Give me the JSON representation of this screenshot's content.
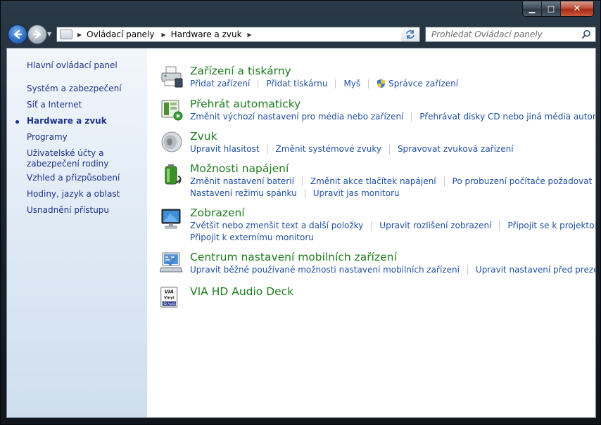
{
  "window": {
    "caption": {
      "minimize": "▁",
      "maximize": "□",
      "close": "✕"
    }
  },
  "navigation": {
    "back_icon": "arrow-left-icon",
    "forward_icon": "arrow-right-icon",
    "breadcrumbs": [
      "Ovládací panely",
      "Hardware a zvuk"
    ],
    "search_placeholder": "Prohledat Ovládací panely"
  },
  "sidebar": {
    "home": "Hlavní ovládací panel",
    "items": [
      {
        "label": "Systém a zabezpečení",
        "active": false
      },
      {
        "label": "Síť a Internet",
        "active": false
      },
      {
        "label": "Hardware a zvuk",
        "active": true
      },
      {
        "label": "Programy",
        "active": false
      },
      {
        "label": "Uživatelské účty a zabezpečení rodiny",
        "active": false
      },
      {
        "label": "Vzhled a přizpůsobení",
        "active": false
      },
      {
        "label": "Hodiny, jazyk a oblast",
        "active": false
      },
      {
        "label": "Usnadnění přístupu",
        "active": false
      }
    ]
  },
  "categories": [
    {
      "title": "Zařízení a tiskárny",
      "icon": "printer-icon",
      "rows": [
        [
          "Přidat zařízení",
          "Přidat tiskárnu",
          "Myš",
          "Správce zařízení"
        ]
      ]
    },
    {
      "title": "Přehrát automaticky",
      "icon": "autoplay-icon",
      "rows": [
        [
          "Změnit výchozí nastavení pro média nebo zařízení",
          "Přehrávat disky CD nebo jiná média automaticky"
        ]
      ]
    },
    {
      "title": "Zvuk",
      "icon": "speaker-icon",
      "rows": [
        [
          "Upravit hlasitost",
          "Změnit systémové zvuky",
          "Spravovat zvuková zařízení"
        ]
      ]
    },
    {
      "title": "Možnosti napájení",
      "icon": "battery-icon",
      "rows": [
        [
          "Změnit nastavení baterií",
          "Změnit akce tlačítek napájení",
          "Po probuzení počítače požadovat heslo"
        ],
        [
          "Nastavení režimu spánku",
          "Upravit jas monitoru"
        ]
      ]
    },
    {
      "title": "Zobrazení",
      "icon": "monitor-icon",
      "rows": [
        [
          "Zvětšit nebo zmenšit text a další položky",
          "Upravit rozlišení zobrazení",
          "Připojit se k projektoru"
        ],
        [
          "Připojit k externímu monitoru"
        ]
      ]
    },
    {
      "title": "Centrum nastavení mobilních zařízení",
      "icon": "mobility-center-icon",
      "rows": [
        [
          "Upravit běžné používané možnosti nastavení mobilních zařízení",
          "Upravit nastavení před prezentací"
        ]
      ]
    },
    {
      "title": "VIA HD Audio Deck",
      "icon": "via-audio-icon",
      "rows": []
    }
  ],
  "via_logo": {
    "top": "VIA",
    "middle": "Vinyl",
    "bottom": "HD Audio"
  },
  "colors": {
    "category_title": "#1e7d1e",
    "link": "#1f4fa0",
    "sidebar_link": "#1e3287"
  }
}
